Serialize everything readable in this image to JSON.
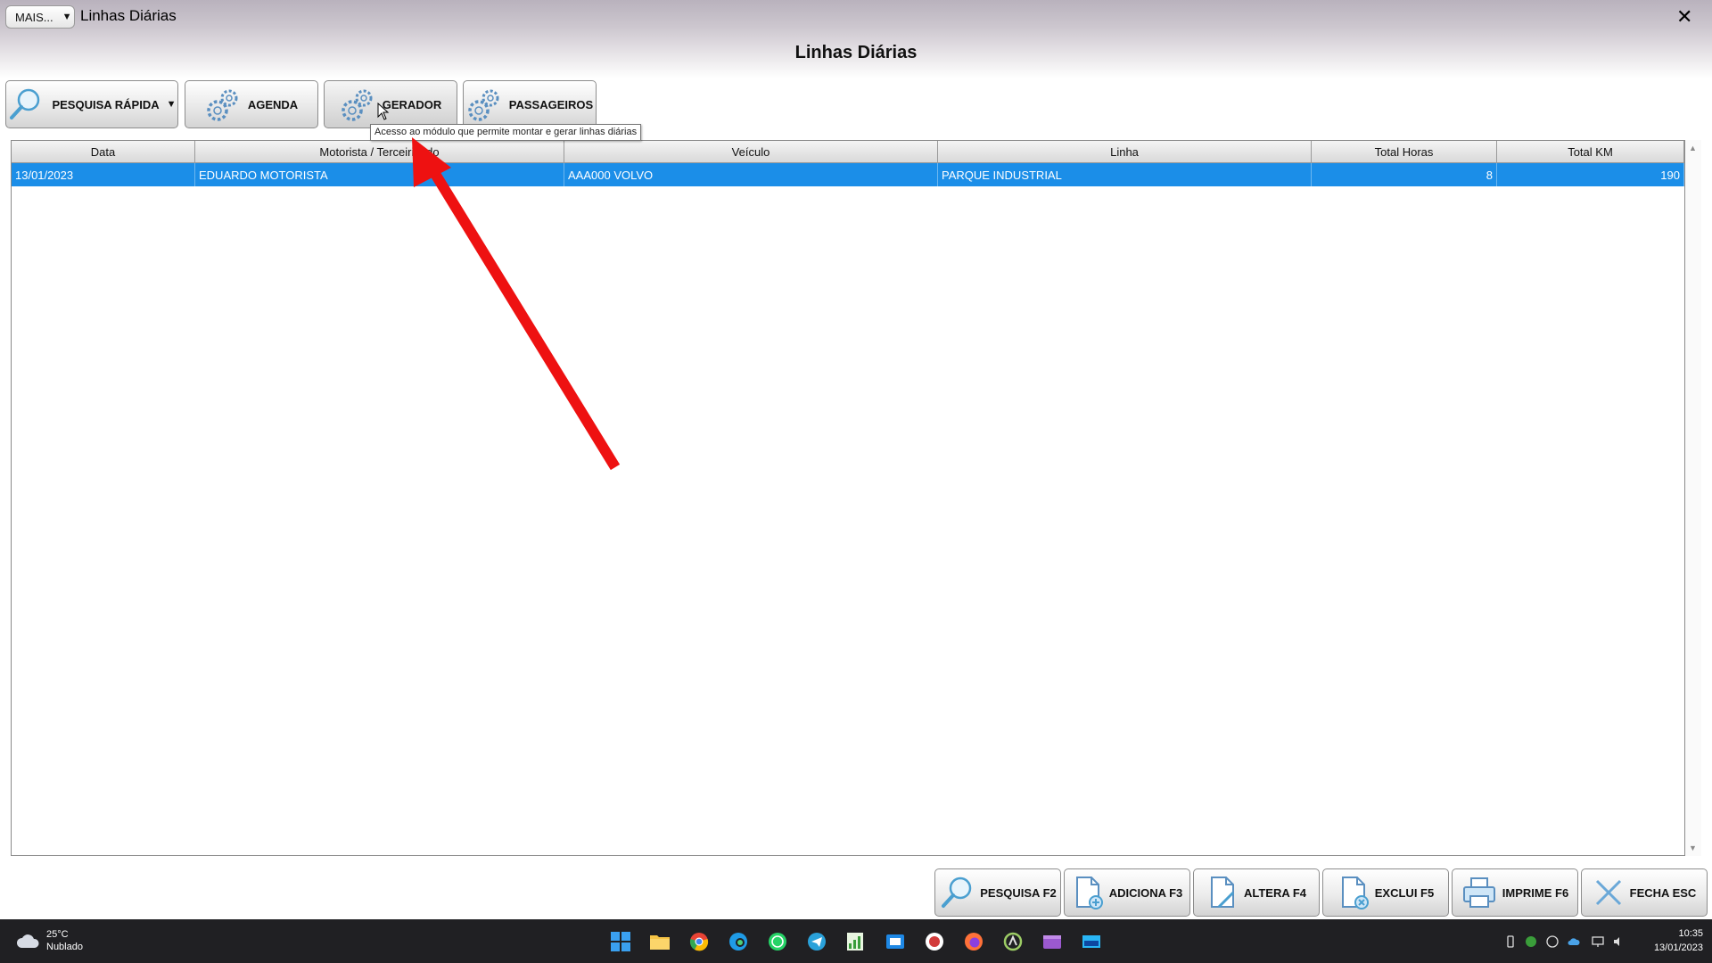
{
  "window": {
    "more_button": "MAIS...",
    "title": "Linhas Diárias",
    "close": "✕",
    "form_title": "Linhas Diárias"
  },
  "toolbar": {
    "pesquisa_rapida": "PESQUISA RÁPIDA",
    "agenda": "AGENDA",
    "gerador": "GERADOR",
    "passageiros": "PASSAGEIROS",
    "tooltip": "Acesso ao módulo que permite montar e gerar linhas diárias"
  },
  "grid": {
    "columns": [
      "Data",
      "Motorista / Terceirizado",
      "Veículo",
      "Linha",
      "Total Horas",
      "Total KM"
    ],
    "rows": [
      [
        "13/01/2023",
        "EDUARDO MOTORISTA",
        "AAA000 VOLVO",
        "PARQUE INDUSTRIAL",
        "8",
        "190"
      ]
    ],
    "selected_color": "#1b8ee8"
  },
  "bottom_bar": {
    "pesquisa": "PESQUISA F2",
    "adiciona": "ADICIONA F3",
    "altera": "ALTERA F4",
    "exclui": "EXCLUI F5",
    "imprime": "IMPRIME F6",
    "fecha": "FECHA ESC"
  },
  "taskbar": {
    "weather_temp": "25°C",
    "weather_desc": "Nublado",
    "time": "10:35",
    "date": "13/01/2023"
  },
  "colors": {
    "annotation_arrow": "#ee1111"
  }
}
